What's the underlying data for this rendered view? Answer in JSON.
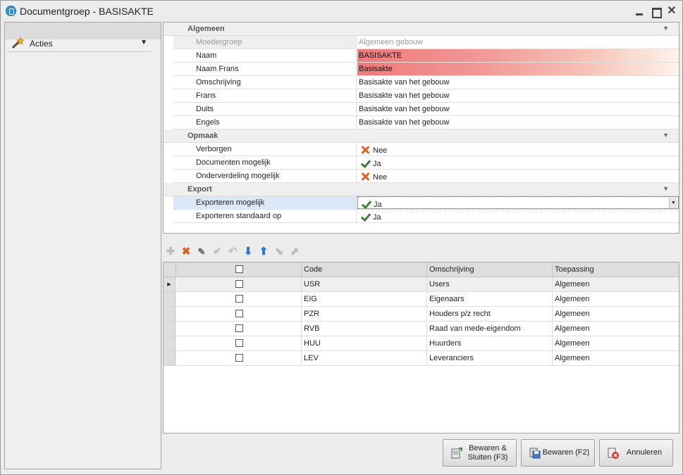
{
  "window": {
    "title": "Documentgroep - BASISAKTE"
  },
  "sidebar": {
    "acties_label": "Acties"
  },
  "properties": {
    "categories": [
      {
        "label": "Algemeen",
        "rows": [
          {
            "name": "Moedergroep",
            "value": "Algemeen gebouw",
            "state": "disabled"
          },
          {
            "name": "Naam",
            "value": "BASISAKTE",
            "state": "required"
          },
          {
            "name": "Naam Frans",
            "value": "Basisakte",
            "state": "required"
          },
          {
            "name": "Omschrijving",
            "value": "Basisakte van het gebouw"
          },
          {
            "name": "Frans",
            "value": "Basisakte van het gebouw"
          },
          {
            "name": "Duits",
            "value": "Basisakte van het gebouw"
          },
          {
            "name": "Engels",
            "value": "Basisakte van het gebouw"
          }
        ]
      },
      {
        "label": "Opmaak",
        "rows": [
          {
            "name": "Verborgen",
            "value": "Nee",
            "icon": "x-icon"
          },
          {
            "name": "Documenten mogelijk",
            "value": "Ja",
            "icon": "check-icon"
          },
          {
            "name": "Onderverdeling mogelijk",
            "value": "Nee",
            "icon": "x-icon"
          }
        ]
      },
      {
        "label": "Export",
        "rows": [
          {
            "name": "Exporteren mogelijk",
            "value": "Ja",
            "icon": "check-icon",
            "selected": true
          },
          {
            "name": "Exporteren standaard op",
            "value": "Ja",
            "icon": "check-icon"
          }
        ]
      }
    ]
  },
  "grid": {
    "columns": [
      "",
      "Code",
      "Omschrijving",
      "Toepassing"
    ],
    "rows": [
      {
        "code": "USR",
        "omschrijving": "Users",
        "toepassing": "Algemeen"
      },
      {
        "code": "EIG",
        "omschrijving": "Eigenaars",
        "toepassing": "Algemeen"
      },
      {
        "code": "PZR",
        "omschrijving": "Houders p/z recht",
        "toepassing": "Algemeen"
      },
      {
        "code": "RVB",
        "omschrijving": "Raad van mede-eigendom",
        "toepassing": "Algemeen"
      },
      {
        "code": "HUU",
        "omschrijving": "Huurders",
        "toepassing": "Algemeen"
      },
      {
        "code": "LEV",
        "omschrijving": "Leveranciers",
        "toepassing": "Algemeen"
      }
    ]
  },
  "buttons": {
    "save_close": "Bewaren &\nSluiten (F3)",
    "save": "Bewaren (F2)",
    "cancel": "Annuleren"
  },
  "colors": {
    "required_bg": "#ee7b7b",
    "check": "#3f7d3a",
    "cross": "#e0602a"
  }
}
